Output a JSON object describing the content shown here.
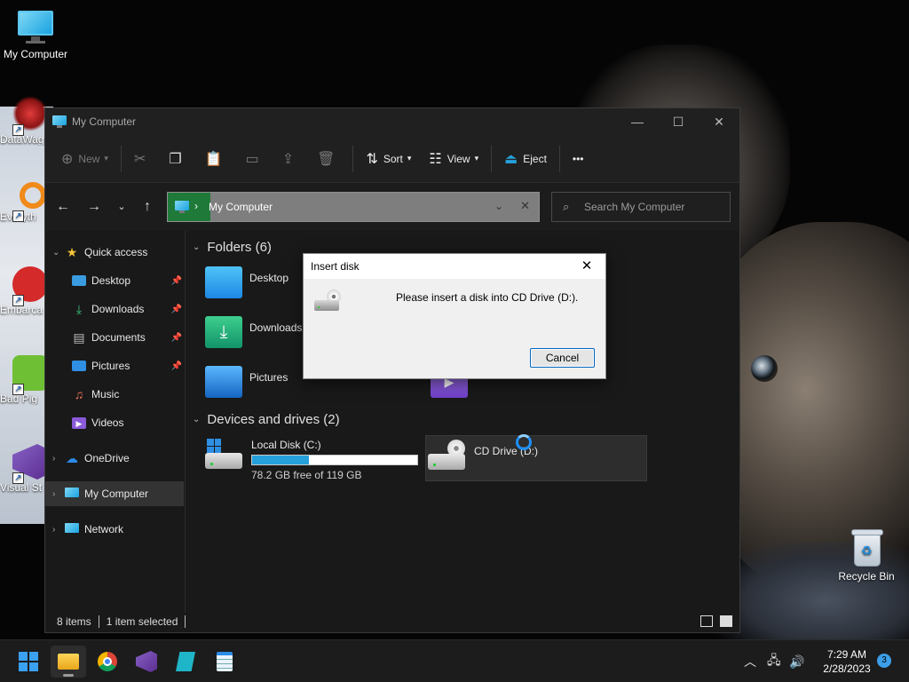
{
  "colors": {
    "accent": "#26a0da",
    "window_bg": "#191919",
    "dialog_bg": "#f0f0f0",
    "selection": "#333333"
  },
  "desktop": {
    "icons": [
      {
        "label": "My Computer",
        "icon": "monitor-icon"
      },
      {
        "label": "DataWag",
        "icon": "datawag-icon"
      },
      {
        "label": "Everyth",
        "icon": "everything-icon"
      },
      {
        "label": "Embarca Dev-C",
        "icon": "devcpp-icon"
      },
      {
        "label": "Bad Pig",
        "icon": "badpiggies-icon"
      },
      {
        "label": "Visual St 2022",
        "icon": "visual-studio-icon"
      },
      {
        "label": "Recycle Bin",
        "icon": "recycle-bin-icon"
      }
    ]
  },
  "explorer": {
    "title": "My Computer",
    "toolbar": {
      "new_label": "New",
      "sort_label": "Sort",
      "view_label": "View",
      "eject_label": "Eject",
      "more_label": "•••"
    },
    "address": {
      "path": "My Computer",
      "search_placeholder": "Search My Computer"
    },
    "sidebar": {
      "quick_access": "Quick access",
      "items": [
        {
          "label": "Desktop",
          "icon": "desktop-icon",
          "pinned": true
        },
        {
          "label": "Downloads",
          "icon": "download-icon",
          "pinned": true
        },
        {
          "label": "Documents",
          "icon": "document-icon",
          "pinned": true
        },
        {
          "label": "Pictures",
          "icon": "picture-icon",
          "pinned": true
        },
        {
          "label": "Music",
          "icon": "music-icon",
          "pinned": false
        },
        {
          "label": "Videos",
          "icon": "video-icon",
          "pinned": false
        }
      ],
      "onedrive": "OneDrive",
      "mycomputer": "My Computer",
      "network": "Network"
    },
    "folders": {
      "heading": "Folders (6)",
      "items": [
        {
          "label": "Desktop"
        },
        {
          "label": "Downloads"
        },
        {
          "label": "Pictures"
        }
      ]
    },
    "drives": {
      "heading": "Devices and drives (2)",
      "local": {
        "name": "Local Disk (C:)",
        "free": "78.2 GB free of 119 GB",
        "used_fraction": 0.343
      },
      "cd": {
        "name": "CD Drive (D:)"
      }
    },
    "status": {
      "items": "8 items",
      "selected": "1 item selected"
    }
  },
  "dialog": {
    "title": "Insert disk",
    "message": "Please insert a disk into CD Drive (D:).",
    "cancel_label": "Cancel"
  },
  "taskbar": {
    "time": "7:29 AM",
    "date": "2/28/2023",
    "notifications": "3"
  }
}
